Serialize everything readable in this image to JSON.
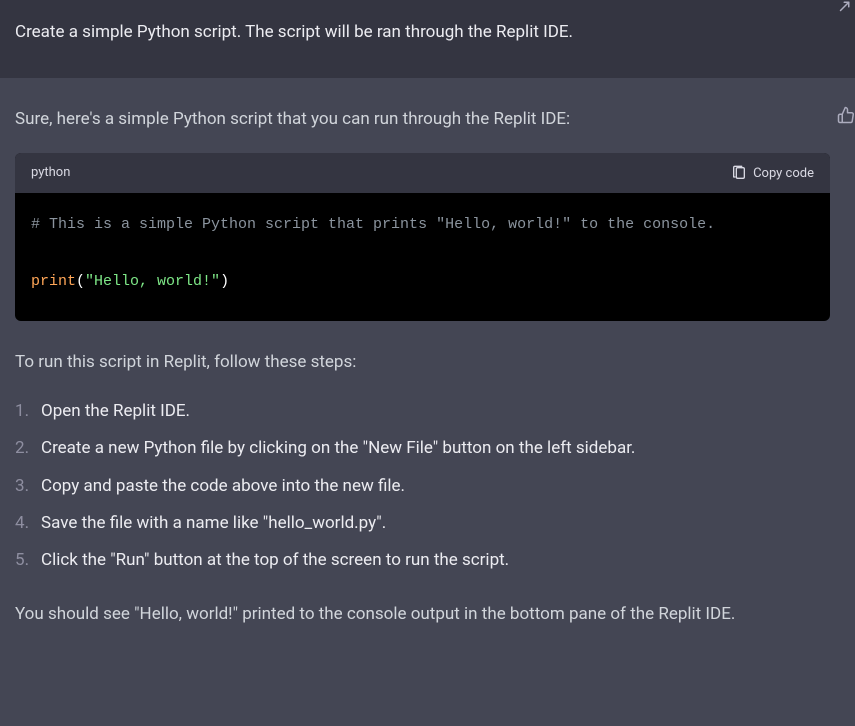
{
  "user": {
    "prompt": "Create a simple Python script. The script will be ran through the Replit IDE."
  },
  "assistant": {
    "intro": "Sure, here's a simple Python script that you can run through the Replit IDE:",
    "code": {
      "language": "python",
      "copy_label": "Copy code",
      "comment": "# This is a simple Python script that prints \"Hello, world!\" to the console.",
      "func": "print",
      "paren_open": "(",
      "string": "\"Hello, world!\"",
      "paren_close": ")"
    },
    "steps_intro": "To run this script in Replit, follow these steps:",
    "steps": [
      "Open the Replit IDE.",
      "Create a new Python file by clicking on the \"New File\" button on the left sidebar.",
      "Copy and paste the code above into the new file.",
      "Save the file with a name like \"hello_world.py\".",
      "Click the \"Run\" button at the top of the screen to run the script."
    ],
    "outro": "You should see \"Hello, world!\" printed to the console output in the bottom pane of the Replit IDE."
  }
}
